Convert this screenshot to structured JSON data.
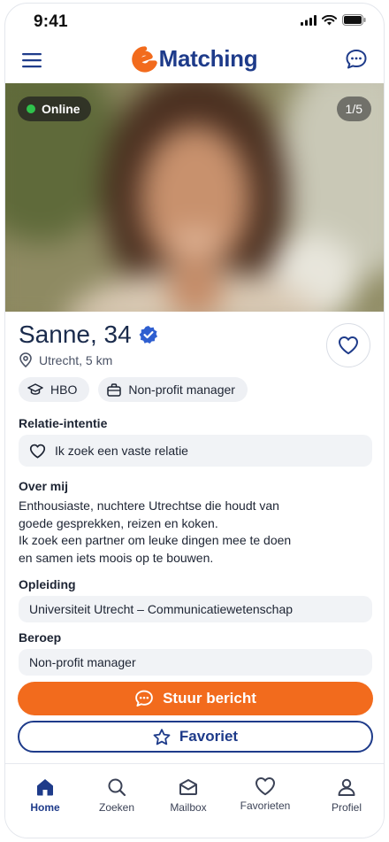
{
  "status_bar": {
    "time": "9:41"
  },
  "header": {
    "logo_text": "Matching"
  },
  "photo": {
    "online_label": "Online",
    "counter": "1/5"
  },
  "profile": {
    "name": "Sanne, 34",
    "location": "Utrecht, 5 km",
    "tags": [
      {
        "icon": "graduation-cap-icon",
        "label": "HBO"
      },
      {
        "icon": "briefcase-icon",
        "label": "Non-profit manager"
      }
    ]
  },
  "sections": {
    "relation": {
      "label": "Relatie-intentie",
      "value": "Ik zoek een vaste relatie"
    },
    "about": {
      "label": "Over mij",
      "lines": [
        "Enthousiaste, nuchtere Utrechtse die houdt van",
        "goede gesprekken, reizen en koken.",
        "Ik zoek een partner om leuke dingen mee te doen",
        "en samen iets moois op te bouwen."
      ]
    },
    "education": {
      "label": "Opleiding",
      "value": "Universiteit Utrecht – Communicatiewetenschap"
    },
    "profession": {
      "label": "Beroep",
      "value": "Non-profit manager"
    }
  },
  "actions": {
    "message_label": "Stuur bericht",
    "favorite_label": "Favoriet"
  },
  "nav": {
    "items": [
      {
        "label": "Home",
        "icon": "home-icon",
        "active": true
      },
      {
        "label": "Zoeken",
        "icon": "search-icon",
        "active": false
      },
      {
        "label": "Mailbox",
        "icon": "mail-icon",
        "active": false
      },
      {
        "label": "Favorieten",
        "icon": "heart-icon",
        "active": false
      },
      {
        "label": "Profiel",
        "icon": "user-icon",
        "active": false
      }
    ]
  },
  "colors": {
    "brand_blue": "#1e3b8a",
    "brand_orange": "#f26b1d",
    "online_green": "#2fc24c",
    "verified_blue": "#2f5fd0"
  }
}
